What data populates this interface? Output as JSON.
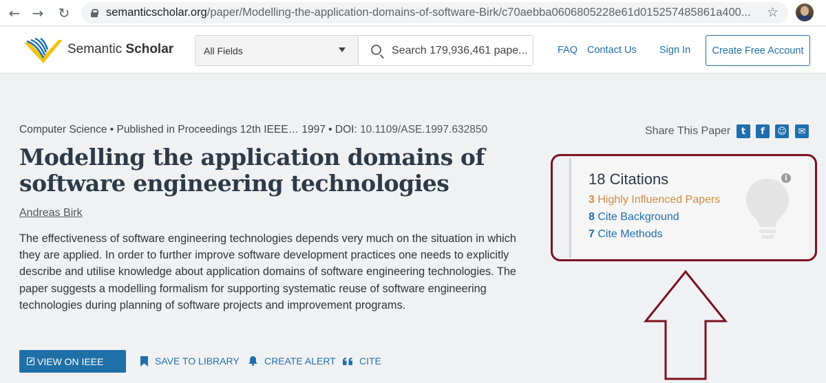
{
  "browser": {
    "url_host": "semanticscholar.org",
    "url_path": "/paper/Modelling-the-application-domains-of-software-Birk/c70aebba0606805228e61d015257485861a400..."
  },
  "header": {
    "brand_light": "Semantic ",
    "brand_bold": "Scholar",
    "fields_label": "All Fields",
    "search_placeholder": "Search 179,936,461 pape...",
    "faq": "FAQ",
    "contact": "Contact Us",
    "sign_in": "Sign In",
    "create_account": "Create Free Account"
  },
  "paper": {
    "meta": "Computer Science • Published in Proceedings 12th IEEE…  1997 • DOI: ",
    "doi": "10.1109/ASE.1997.632850",
    "title": "Modelling the application domains of software engineering technologies",
    "author": "Andreas Birk",
    "abstract": "The effectiveness of software engineering technologies depends very much on the situation in which they are applied. In order to further improve software development practices one needs to explicitly describe and utilise knowledge about application domains of software engineering technologies. The paper suggests a modelling formalism for supporting systematic reuse of software engineering technologies during planning of software projects and improvement programs."
  },
  "actions": {
    "view": "VIEW ON IEEE",
    "save": "SAVE TO LIBRARY",
    "alert": "CREATE ALERT",
    "cite": "CITE"
  },
  "share": {
    "label": "Share This Paper"
  },
  "citations": {
    "title": "18 Citations",
    "influenced_count": "3",
    "influenced_label": " Highly Influenced Papers",
    "background_count": "8",
    "background_label": " Cite Background",
    "methods_count": "7",
    "methods_label": " Cite Methods"
  },
  "colors": {
    "link": "#1f6fae",
    "button": "#1f70a8",
    "influenced": "#d48a3c",
    "annotation": "#7a1020"
  },
  "icons": [
    "back-icon",
    "forward-icon",
    "reload-icon",
    "lock-icon",
    "star-icon",
    "search-icon",
    "twitter-icon",
    "facebook-icon",
    "reddit-icon",
    "email-icon",
    "bulb-icon",
    "info-icon",
    "bookmark-icon",
    "bell-icon",
    "quote-icon",
    "external-link-icon"
  ]
}
